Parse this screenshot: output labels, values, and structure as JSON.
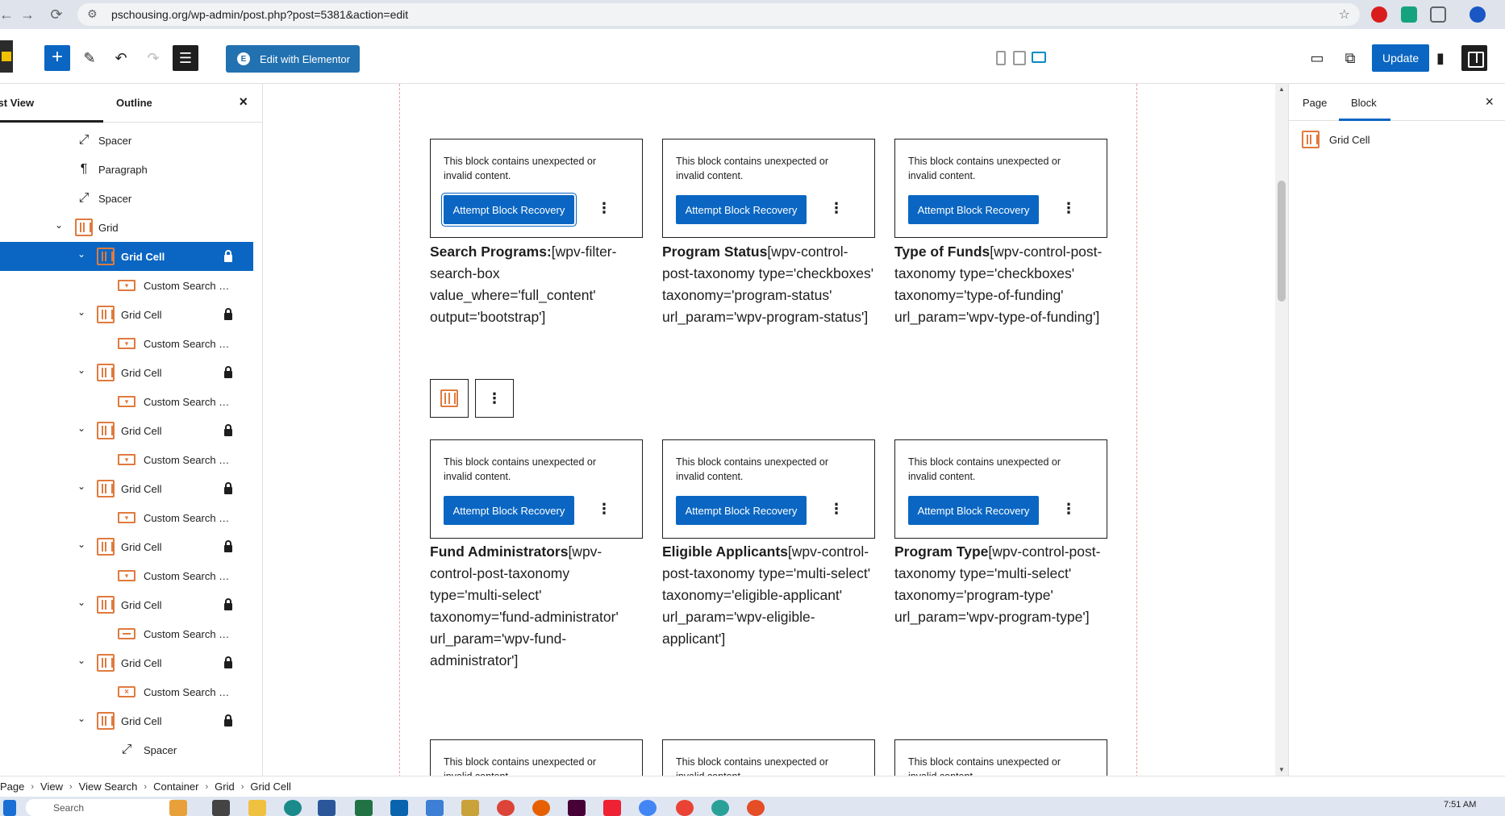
{
  "browser": {
    "url": "pschousing.org/wp-admin/post.php?post=5381&action=edit"
  },
  "toolbar": {
    "edit_with_elementor": "Edit with Elementor",
    "elementor_badge": "E",
    "update_label": "Update"
  },
  "left_panel": {
    "tab_list_view": "List View",
    "tab_outline": "Outline",
    "close": "×",
    "items": [
      {
        "label": "Spacer",
        "depth": 0,
        "icon": "resize-icon",
        "expand": false,
        "lock": false
      },
      {
        "label": "Paragraph",
        "depth": 0,
        "icon": "paragraph-icon",
        "expand": false,
        "lock": false
      },
      {
        "label": "Spacer",
        "depth": 0,
        "icon": "resize-icon",
        "expand": false,
        "lock": false
      },
      {
        "label": "Grid",
        "depth": 0,
        "icon": "grid-icon",
        "expand": true,
        "lock": false
      },
      {
        "label": "Grid Cell",
        "depth": 1,
        "icon": "grid-icon",
        "expand": true,
        "lock": true,
        "selected": true
      },
      {
        "label": "Custom Search Filter",
        "depth": 2,
        "icon": "filter-icon",
        "expand": false,
        "lock": false
      },
      {
        "label": "Grid Cell",
        "depth": 1,
        "icon": "grid-icon",
        "expand": true,
        "lock": true
      },
      {
        "label": "Custom Search Filter",
        "depth": 2,
        "icon": "filter-icon",
        "expand": false,
        "lock": false
      },
      {
        "label": "Grid Cell",
        "depth": 1,
        "icon": "grid-icon",
        "expand": true,
        "lock": true
      },
      {
        "label": "Custom Search Filter",
        "depth": 2,
        "icon": "filter-icon",
        "expand": false,
        "lock": false
      },
      {
        "label": "Grid Cell",
        "depth": 1,
        "icon": "grid-icon",
        "expand": true,
        "lock": true
      },
      {
        "label": "Custom Search Filter",
        "depth": 2,
        "icon": "filter-icon",
        "expand": false,
        "lock": false
      },
      {
        "label": "Grid Cell",
        "depth": 1,
        "icon": "grid-icon",
        "expand": true,
        "lock": true
      },
      {
        "label": "Custom Search Filter",
        "depth": 2,
        "icon": "filter-icon",
        "expand": false,
        "lock": false
      },
      {
        "label": "Grid Cell",
        "depth": 1,
        "icon": "grid-icon",
        "expand": true,
        "lock": true
      },
      {
        "label": "Custom Search Filter",
        "depth": 2,
        "icon": "filter-icon",
        "expand": false,
        "lock": false
      },
      {
        "label": "Grid Cell",
        "depth": 1,
        "icon": "grid-icon",
        "expand": true,
        "lock": true
      },
      {
        "label": "Custom Search Su...",
        "depth": 2,
        "icon": "submit-icon",
        "expand": false,
        "lock": false
      },
      {
        "label": "Grid Cell",
        "depth": 1,
        "icon": "grid-icon",
        "expand": true,
        "lock": true
      },
      {
        "label": "Custom Search Res...",
        "depth": 2,
        "icon": "results-icon",
        "expand": false,
        "lock": false
      },
      {
        "label": "Grid Cell",
        "depth": 1,
        "icon": "grid-icon",
        "expand": true,
        "lock": true
      },
      {
        "label": "Spacer",
        "depth": 2,
        "icon": "resize-icon",
        "expand": false,
        "lock": false
      }
    ]
  },
  "canvas": {
    "warning_text": "This block contains unexpected or invalid content.",
    "recover_label": "Attempt Block Recovery",
    "blocks": [
      {
        "title": "Search Programs:",
        "code": "[wpv-filter-search-box value_where='full_content' output='bootstrap']"
      },
      {
        "title": "Program Status",
        "code": "[wpv-control-post-taxonomy type='checkboxes' taxonomy='program-status' url_param='wpv-program-status']"
      },
      {
        "title": "Type of Funds",
        "code": "[wpv-control-post-taxonomy type='checkboxes' taxonomy='type-of-funding' url_param='wpv-type-of-funding']"
      },
      {
        "title": "Fund Administrators",
        "code": "[wpv-control-post-taxonomy type='multi-select' taxonomy='fund-administrator' url_param='wpv-fund-administrator']"
      },
      {
        "title": "Eligible Applicants",
        "code": "[wpv-control-post-taxonomy type='multi-select' taxonomy='eligible-applicant' url_param='wpv-eligible-applicant']"
      },
      {
        "title": "Program Type",
        "code": "[wpv-control-post-taxonomy type='multi-select' taxonomy='program-type' url_param='wpv-program-type']"
      }
    ]
  },
  "right_panel": {
    "tab_page": "Page",
    "tab_block": "Block",
    "close": "×",
    "block_name": "Grid Cell"
  },
  "breadcrumb": [
    "Page",
    "View",
    "View Search",
    "Container",
    "Grid",
    "Grid Cell"
  ],
  "taskbar": {
    "search_placeholder": "Search",
    "time": "7:51 AM"
  },
  "colors": {
    "wp_blue": "#0a66c2",
    "block_icon_orange": "#e07a3e",
    "dashed_guide": "#e5a0a0"
  }
}
